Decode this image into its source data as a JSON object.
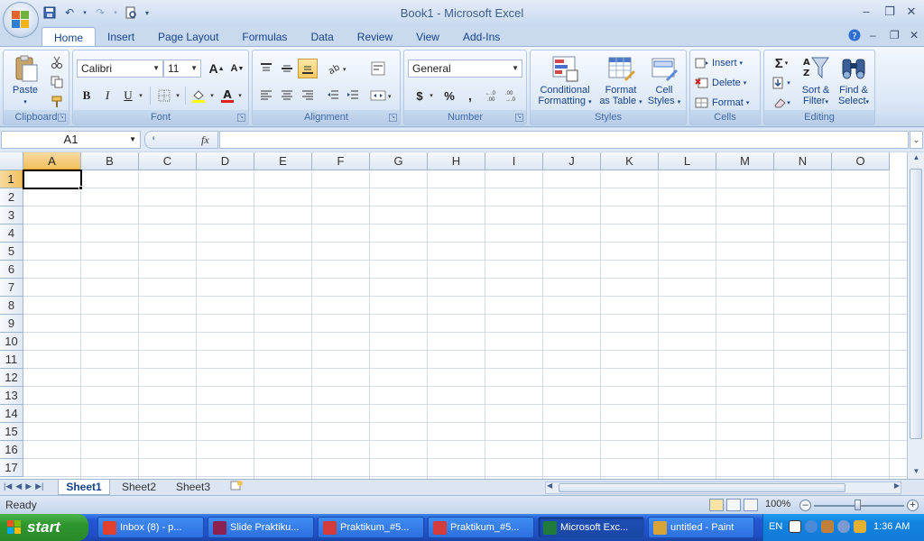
{
  "window": {
    "title": "Book1 - Microsoft Excel"
  },
  "tabs": [
    "Home",
    "Insert",
    "Page Layout",
    "Formulas",
    "Data",
    "Review",
    "View",
    "Add-Ins"
  ],
  "ribbon": {
    "clipboard": {
      "label": "Clipboard",
      "paste": "Paste"
    },
    "font": {
      "label": "Font",
      "font_name": "Calibri",
      "font_size": "11",
      "bold": "B",
      "italic": "I",
      "underline": "U",
      "grow": "A",
      "shrink": "A"
    },
    "alignment": {
      "label": "Alignment"
    },
    "number": {
      "label": "Number",
      "format": "General",
      "currency": "$",
      "percent": "%",
      "comma": ","
    },
    "styles": {
      "label": "Styles",
      "conditional_line1": "Conditional",
      "conditional_line2": "Formatting",
      "table_line1": "Format",
      "table_line2": "as Table",
      "cell_line1": "Cell",
      "cell_line2": "Styles"
    },
    "cells": {
      "label": "Cells",
      "insert": "Insert",
      "delete": "Delete",
      "format": "Format"
    },
    "editing": {
      "label": "Editing",
      "sigma": "Σ",
      "sort_line1": "Sort &",
      "sort_line2": "Filter",
      "find_line1": "Find &",
      "find_line2": "Select"
    }
  },
  "formula_bar": {
    "name_box": "A1",
    "fx": "fx",
    "value": ""
  },
  "grid": {
    "columns": [
      "A",
      "B",
      "C",
      "D",
      "E",
      "F",
      "G",
      "H",
      "I",
      "J",
      "K",
      "L",
      "M",
      "N",
      "O"
    ],
    "rows": [
      "1",
      "2",
      "3",
      "4",
      "5",
      "6",
      "7",
      "8",
      "9",
      "10",
      "11",
      "12",
      "13",
      "14",
      "15",
      "16",
      "17"
    ],
    "active_cell": "A1"
  },
  "sheets": [
    "Sheet1",
    "Sheet2",
    "Sheet3"
  ],
  "status": {
    "text": "Ready",
    "zoom": "100%"
  },
  "taskbar": {
    "start": "start",
    "tasks": [
      {
        "label": "Inbox (8) - p...",
        "icon": "chrome-icon",
        "color": "#e0412f"
      },
      {
        "label": "Slide Praktiku...",
        "icon": "winrar-icon",
        "color": "#8b2252"
      },
      {
        "label": "Praktikum_#5...",
        "icon": "pdf-icon",
        "color": "#d23c3c"
      },
      {
        "label": "Praktikum_#5...",
        "icon": "pdf-icon",
        "color": "#d23c3c"
      },
      {
        "label": "Microsoft Exc...",
        "icon": "excel-icon",
        "color": "#1f7a3b"
      },
      {
        "label": "untitled - Paint",
        "icon": "paint-icon",
        "color": "#d8a43a"
      }
    ],
    "language": "EN",
    "clock": "1:36 AM"
  }
}
